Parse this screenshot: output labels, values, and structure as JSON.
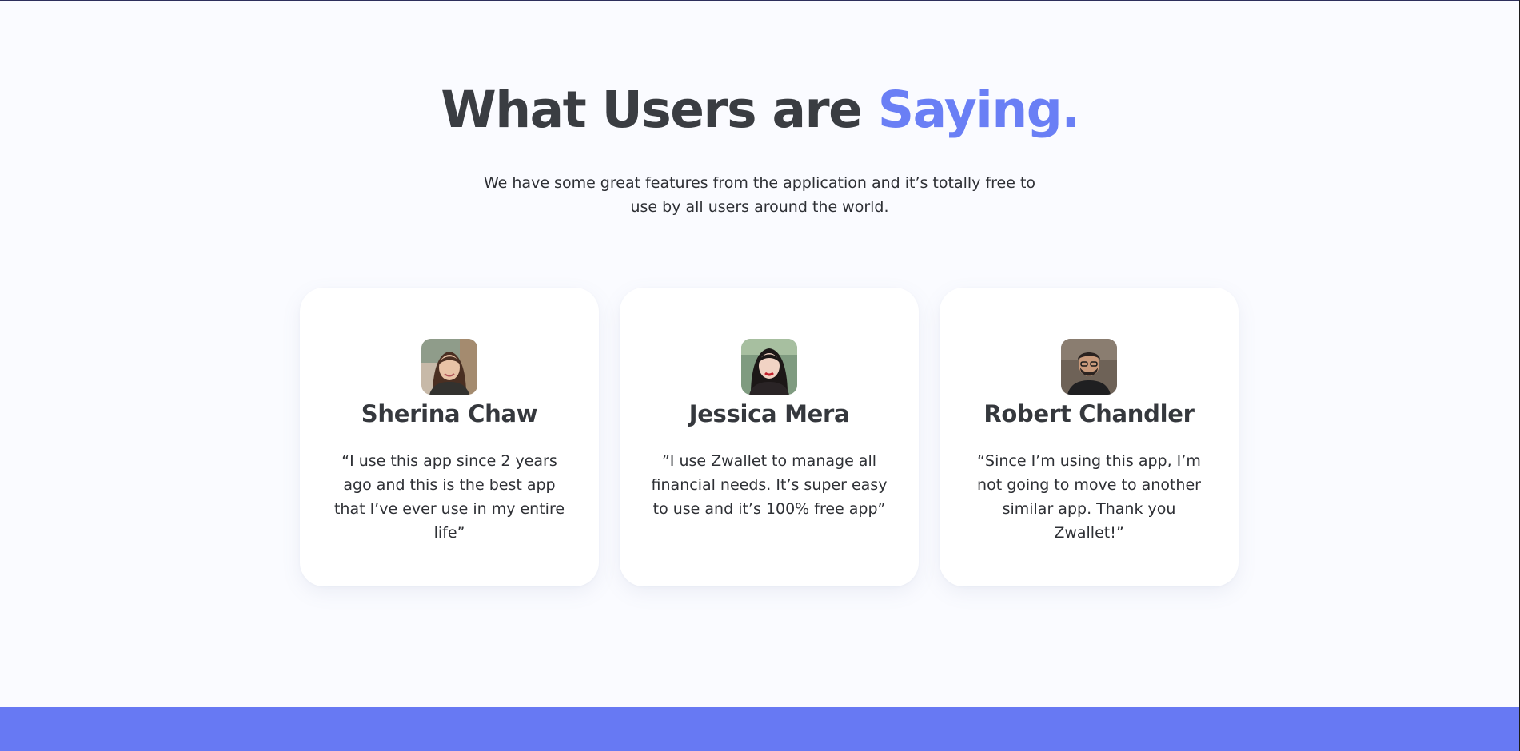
{
  "section": {
    "heading_main": "What Users are ",
    "heading_accent": "Saying.",
    "subtitle": "We have some great features from the application and it’s totally free to use by all users around the world."
  },
  "testimonials": [
    {
      "name": "Sherina Chaw",
      "quote": "“I use this app since 2 years ago and this is the best app that I’ve ever use in my entire life”",
      "avatar_icon": "woman-portrait-avatar"
    },
    {
      "name": "Jessica Mera",
      "quote": "”I use Zwallet to manage all financial needs. It’s super easy to use and it’s 100% free app”",
      "avatar_icon": "woman-portrait-avatar"
    },
    {
      "name": "Robert Chandler",
      "quote": "“Since I’m using this app, I’m not going to move to another similar app. Thank you Zwallet!”",
      "avatar_icon": "man-portrait-avatar"
    }
  ],
  "colors": {
    "accent": "#6a7ff5",
    "heading": "#3a3d42",
    "background": "#fafbff",
    "footer_band": "#6779f3"
  }
}
